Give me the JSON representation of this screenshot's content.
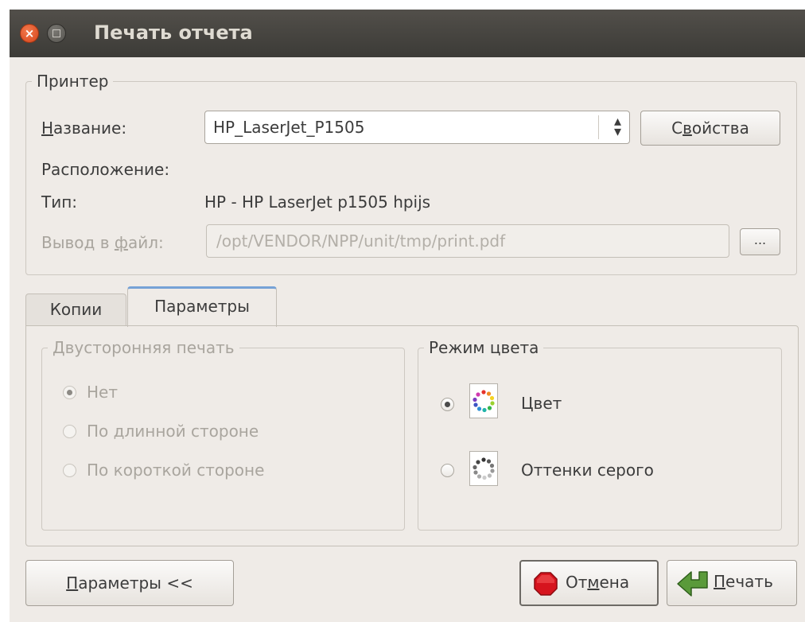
{
  "window": {
    "title": "Печать отчета"
  },
  "printer": {
    "legend": "Принтер",
    "name_label_u": "Н",
    "name_label_rest": "азвание:",
    "name_value": "HP_LaserJet_P1505",
    "properties_btn_pre": "С",
    "properties_btn_u": "в",
    "properties_btn_post": "ойства",
    "location_label": "Расположение:",
    "location_value": "",
    "type_label": "Тип:",
    "type_value": "HP - HP LaserJet p1505 hpijs",
    "file_label_pre": "Вывод в ",
    "file_label_u": "ф",
    "file_label_post": "айл:",
    "file_value": "/opt/VENDOR/NPP/unit/tmp/print.pdf",
    "browse_btn": "..."
  },
  "tabs": [
    {
      "label": "Копии",
      "active": false
    },
    {
      "label": "Параметры",
      "active": true
    }
  ],
  "duplex": {
    "legend": "Двусторонняя печать",
    "options": [
      {
        "label": "Нет",
        "checked": true
      },
      {
        "label": "По длинной стороне",
        "checked": false
      },
      {
        "label": "По короткой стороне",
        "checked": false
      }
    ]
  },
  "color_mode": {
    "legend": "Режим цвета",
    "options": [
      {
        "label": "Цвет",
        "checked": true,
        "icon": "color-palette-icon"
      },
      {
        "label": "Оттенки серого",
        "checked": false,
        "icon": "grayscale-palette-icon"
      }
    ]
  },
  "footer": {
    "params_btn_u": "П",
    "params_btn_rest": "араметры <<",
    "cancel_btn_pre": "От",
    "cancel_btn_u": "м",
    "cancel_btn_post": "ена",
    "print_btn_u": "П",
    "print_btn_rest": "ечать"
  },
  "colors": {
    "titlebar": "#3c3b37",
    "window_bg": "#efebe7",
    "close": "#e05a2c",
    "active_tab_accent": "#76a2d6",
    "stop": "#d6141e",
    "print_arrow": "#5a9a3a"
  }
}
